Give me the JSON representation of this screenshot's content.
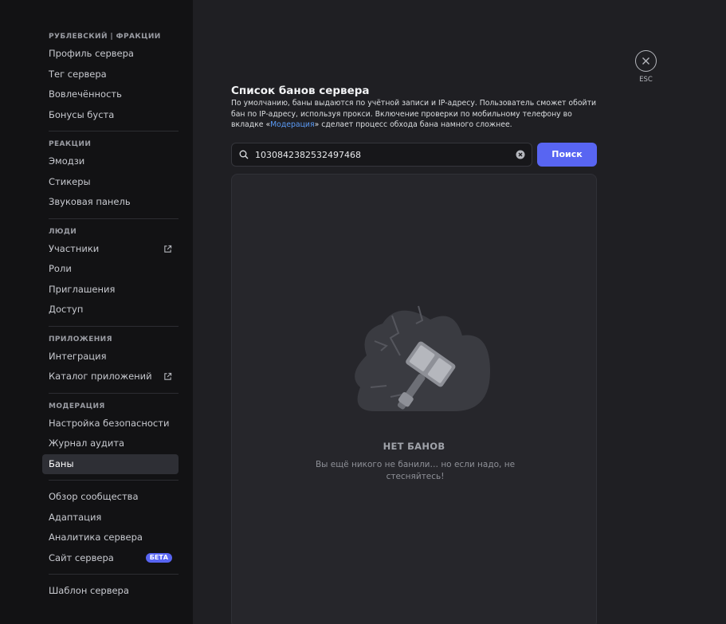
{
  "sidebar": {
    "groups": [
      {
        "title": "РУБЛЕВСКИЙ | ФРАКЦИИ",
        "items": [
          "Профиль сервера",
          "Тег сервера",
          "Вовлечённость",
          "Бонусы буста"
        ]
      },
      {
        "title": "РЕАКЦИИ",
        "items": [
          "Эмодзи",
          "Стикеры",
          "Звуковая панель"
        ]
      },
      {
        "title": "ЛЮДИ",
        "items": [
          "Участники",
          "Роли",
          "Приглашения",
          "Доступ"
        ]
      },
      {
        "title": "ПРИЛОЖЕНИЯ",
        "items": [
          "Интеграция",
          "Каталог приложений"
        ]
      },
      {
        "title": "МОДЕРАЦИЯ",
        "items": [
          "Настройка безопасности",
          "Журнал аудита",
          "Баны"
        ]
      },
      {
        "title": "",
        "items": [
          "Обзор сообщества",
          "Адаптация",
          "Аналитика сервера",
          "Сайт сервера"
        ]
      },
      {
        "title": "",
        "items": [
          "Шаблон сервера"
        ]
      }
    ],
    "beta_label": "БЕТА",
    "active_item": "Баны"
  },
  "close": {
    "esc_label": "ESC"
  },
  "content": {
    "title": "Список банов сервера",
    "desc_part1": "По умолчанию, баны выдаются по учётной записи и IP-адресу. Пользователь сможет обойти бан по IP-адресу, используя прокси. Включение проверки по мобильному телефону во вкладке «",
    "desc_link": "Модерация",
    "desc_part2": "» сделает процесс обхода бана намного сложнее.",
    "search_value": "1030842382532497468",
    "search_button": "Поиск",
    "empty_title": "НЕТ БАНОВ",
    "empty_text": "Вы ещё никого не банили… но если надо, не стесняйтесь!"
  },
  "colors": {
    "accent": "#5865f2",
    "link": "#5b9bf6"
  }
}
